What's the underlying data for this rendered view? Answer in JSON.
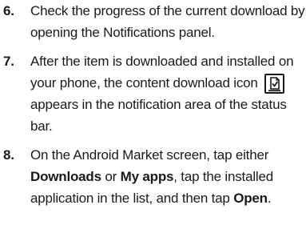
{
  "steps": [
    {
      "number": "6.",
      "text": "Check the progress of the current download by opening the Notifications panel."
    },
    {
      "number": "7.",
      "text_before_icon": "After the item is downloaded and installed on your phone, the content download icon",
      "icon": "content-download-icon",
      "text_after_icon": "appears in the notification area of the status bar."
    },
    {
      "number": "8.",
      "segments": [
        "On the Android Market screen, tap either ",
        "Downloads",
        " or ",
        "My apps",
        ", tap the installed application in the list, and then tap ",
        "Open",
        "."
      ]
    }
  ]
}
